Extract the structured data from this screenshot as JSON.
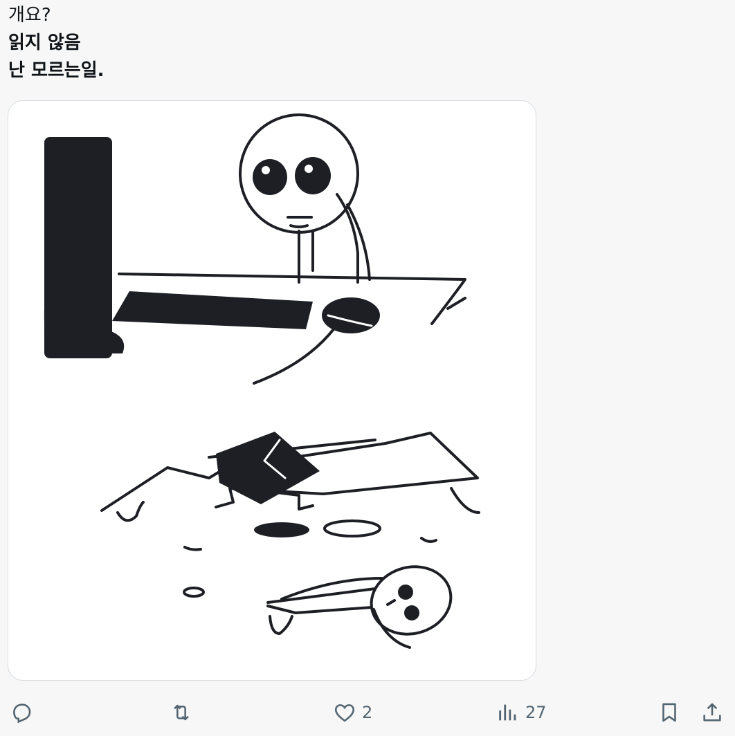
{
  "tweet": {
    "lines": [
      "개요?",
      "읽지 않음",
      "난 모르는일."
    ]
  },
  "media": {
    "description_icon": "stick-figure-desk-comic"
  },
  "actions": {
    "reply": {
      "icon": "reply-icon",
      "count": ""
    },
    "retweet": {
      "icon": "retweet-icon",
      "count": ""
    },
    "like": {
      "icon": "heart-icon",
      "count": "2"
    },
    "views": {
      "icon": "views-icon",
      "count": "27"
    },
    "bookmark": {
      "icon": "bookmark-icon"
    },
    "share": {
      "icon": "share-icon"
    }
  },
  "colors": {
    "background": "#f7f7f7",
    "text": "#0f1419",
    "icon": "#536471",
    "card_border": "#d5dadf",
    "ink": "#1d1f24"
  }
}
